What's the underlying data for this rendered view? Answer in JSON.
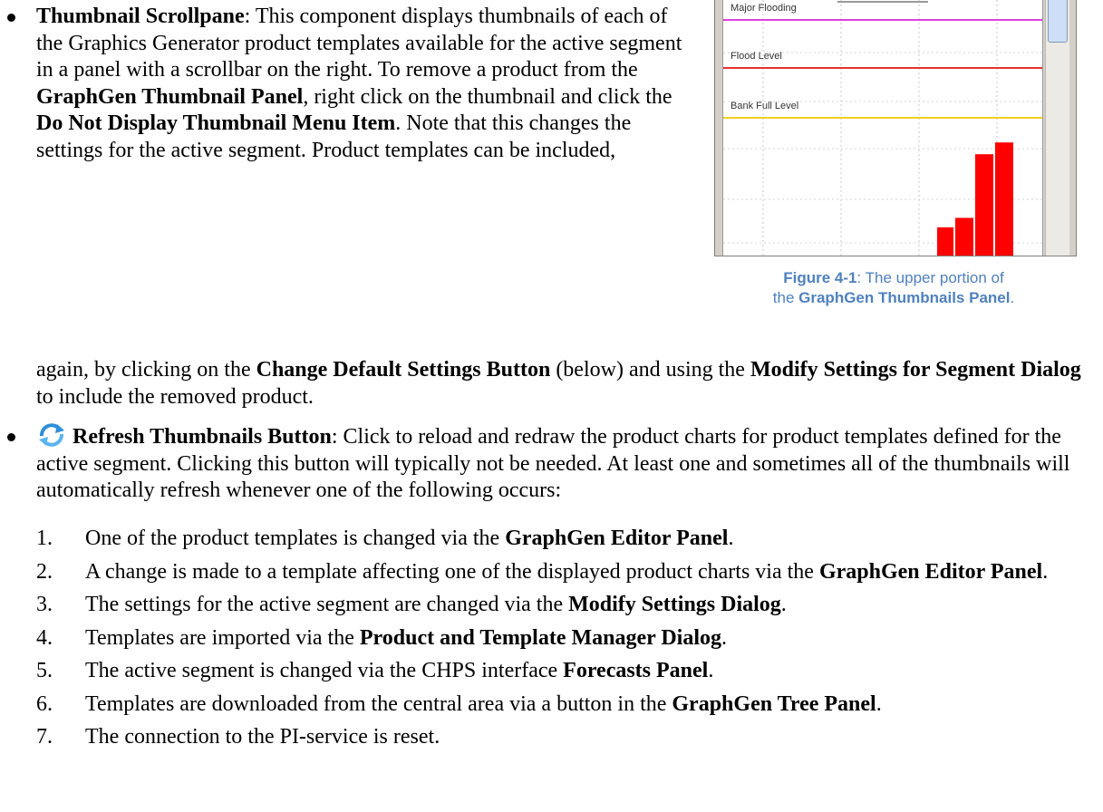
{
  "bullet1": {
    "title": "Thumbnail Scrollpane",
    "t1": ": This component displays thumbnails of each of the Graphics Generator product templates available for the active segment in a panel with a scrollbar on the right. To remove a product from the ",
    "b1": "GraphGen Thumbnail Panel",
    "t2": ", right click on the thumbnail and click the ",
    "b2": "Do Not Display Thumbnail Menu Item",
    "t3": ". Note that this changes the settings for the active segment. Product templates can be included,",
    "t4": "again, by clicking on the ",
    "b3": "Change Default Settings Button",
    "t5": " (below) and using the ",
    "b4": "Modify Settings for Segment Dialog",
    "t6": " to include the removed product."
  },
  "bullet2": {
    "icon": "refresh-icon",
    "title": "Refresh Thumbnails Button",
    "text": ": Click to reload and redraw the product charts for product templates defined for the active segment. Clicking this button will typically not be needed. At least one and sometimes all of the thumbnails will automatically refresh whenever one of the following occurs:"
  },
  "list": [
    {
      "num": "1.",
      "a": "One of the product templates is changed via the ",
      "b": "GraphGen Editor Panel",
      "c": "."
    },
    {
      "num": "2.",
      "a": "A change is made to a template affecting one of the displayed product charts via the ",
      "b": "GraphGen Editor Panel",
      "c": "."
    },
    {
      "num": "3.",
      "a": "The settings for the active segment are changed via the ",
      "b": "Modify Settings Dialog",
      "c": "."
    },
    {
      "num": "4.",
      "a": "Templates are imported via the ",
      "b": "Product and Template Manager Dialog",
      "c": "."
    },
    {
      "num": "5.",
      "a": "The active segment is changed via the CHPS interface ",
      "b": "Forecasts Panel",
      "c": "."
    },
    {
      "num": "6.",
      "a": "Templates are downloaded from the central area via a button in the ",
      "b": "GraphGen Tree Panel",
      "c": "."
    },
    {
      "num": "7.",
      "a": "The connection to the PI-service is reset.",
      "b": "",
      "c": ""
    }
  ],
  "figure": {
    "chart_data": {
      "type": "bar",
      "title": "",
      "threshold_lines": [
        {
          "label": "Major Flooding",
          "color": "#e040e0"
        },
        {
          "label": "Flood Level",
          "color": "#e83030"
        },
        {
          "label": "Bank Full Level",
          "color": "#f0d020"
        }
      ],
      "bar_color": "#ff0000",
      "series": [
        {
          "values": [
            0.12,
            0.16,
            0.43,
            0.48
          ]
        }
      ],
      "grid": true
    },
    "caption_label": "Figure 4-1",
    "caption_text1": ": The upper portion of",
    "caption_text2": "the ",
    "caption_bold": "GraphGen Thumbnails Panel",
    "caption_end": "."
  }
}
